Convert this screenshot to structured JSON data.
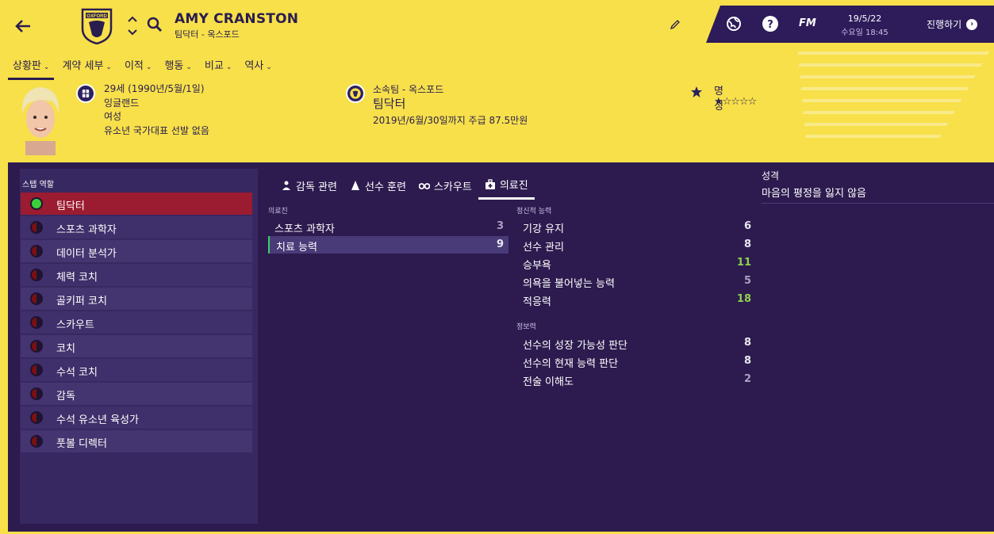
{
  "header": {
    "name": "AMY CRANSTON",
    "subtitle": "팀닥터 - 옥스포드",
    "club_crest_text": "OXFORD"
  },
  "topbar": {
    "date": "19/5/22",
    "day_time": "수요일 18:45",
    "fm_label": "FM",
    "continue_label": "진행하기"
  },
  "menu": [
    {
      "label": "상황판"
    },
    {
      "label": "계약 세부"
    },
    {
      "label": "이적"
    },
    {
      "label": "행동"
    },
    {
      "label": "비교"
    },
    {
      "label": "역사"
    }
  ],
  "profile": {
    "age_birth": "29세 (1990년/5월/1일)",
    "nation": "잉글랜드",
    "gender": "여성",
    "youth_caps": "유소년 국가대표 선발 없음",
    "club_label": "소속팀 - 옥스포드",
    "role": "팀닥터",
    "contract": "2019년/6월/30일까지 주급 87.5만원",
    "reputation_label": "명성",
    "reputation_stars": "★☆☆☆☆"
  },
  "staff_roles": {
    "title": "스텝 역할",
    "items": [
      {
        "label": "팀닥터"
      },
      {
        "label": "스포츠 과학자"
      },
      {
        "label": "데이터 분석가"
      },
      {
        "label": "체력 코치"
      },
      {
        "label": "골키퍼 코치"
      },
      {
        "label": "스카우트"
      },
      {
        "label": "코치"
      },
      {
        "label": "수석 코치"
      },
      {
        "label": "감독"
      },
      {
        "label": "수석 유소년 육성가"
      },
      {
        "label": "풋볼 디렉터"
      }
    ]
  },
  "tabs": [
    {
      "label": "감독 관련"
    },
    {
      "label": "선수 훈련"
    },
    {
      "label": "스카우트"
    },
    {
      "label": "의료진"
    }
  ],
  "medical": {
    "label": "의료진",
    "rows": [
      {
        "label": "스포츠 과학자",
        "value": "3"
      },
      {
        "label": "치료 능력",
        "value": "9"
      }
    ]
  },
  "mental": {
    "label": "정신적 능력",
    "rows": [
      {
        "label": "기강 유지",
        "value": "6"
      },
      {
        "label": "선수 관리",
        "value": "8"
      },
      {
        "label": "승부욕",
        "value": "11"
      },
      {
        "label": "의욕을 불어넣는 능력",
        "value": "5"
      },
      {
        "label": "적응력",
        "value": "18"
      }
    ]
  },
  "knowledge": {
    "label": "정보력",
    "rows": [
      {
        "label": "선수의 성장 가능성 판단",
        "value": "8"
      },
      {
        "label": "선수의 현재 능력 판단",
        "value": "8"
      },
      {
        "label": "전술 이해도",
        "value": "2"
      }
    ]
  },
  "personality": {
    "label": "성격",
    "value": "마음의 평정을 잃지 않음"
  }
}
